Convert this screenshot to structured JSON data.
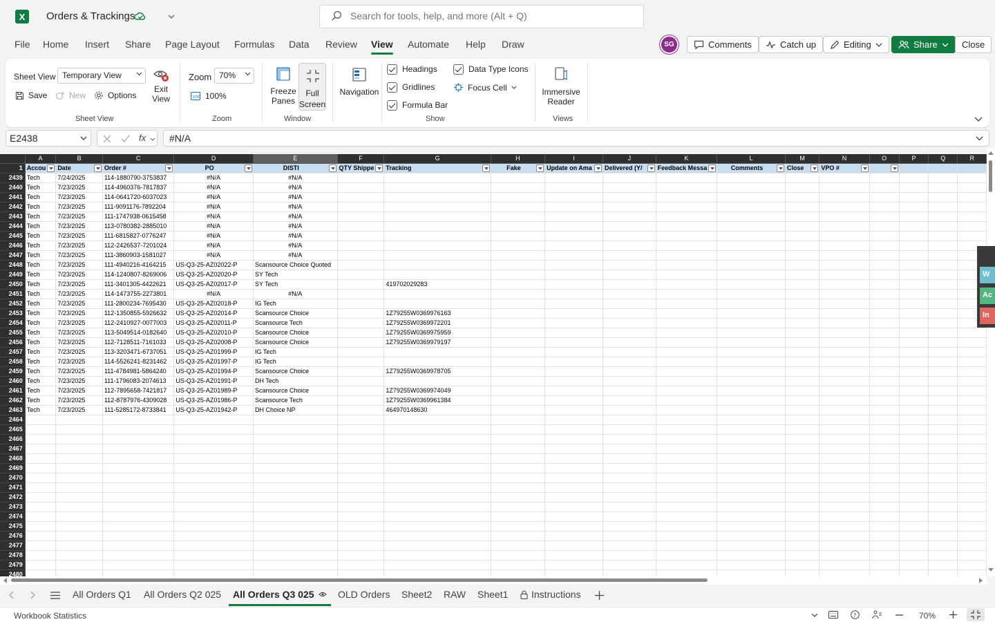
{
  "title": {
    "app_logo": "X",
    "doc_title": "Orders & Trackings"
  },
  "search": {
    "placeholder": "Search for tools, help, and more (Alt + Q)"
  },
  "menu": [
    "File",
    "Home",
    "Insert",
    "Share",
    "Page Layout",
    "Formulas",
    "Data",
    "Review",
    "View",
    "Automate",
    "Help",
    "Draw"
  ],
  "menu_active": "View",
  "account": {
    "initials": "SG"
  },
  "top_buttons": {
    "comments": "Comments",
    "catch_up": "Catch up",
    "editing": "Editing",
    "share": "Share",
    "close": "Close"
  },
  "ribbon": {
    "sheet_view_label": "Sheet View",
    "sheet_view_value": "Temporary View",
    "save": "Save",
    "new": "New",
    "options": "Options",
    "exit": "Exit",
    "view": "View",
    "group_sheet_view": "Sheet View",
    "zoom_label": "Zoom",
    "zoom_value": "70%",
    "zoom_100": "100%",
    "group_zoom": "Zoom",
    "freeze": "Freeze",
    "panes": "Panes",
    "full": "Full",
    "screen": "Screen",
    "group_window": "Window",
    "navigation": "Navigation",
    "headings": "Headings",
    "gridlines": "Gridlines",
    "formula_bar": "Formula Bar",
    "data_type_icons": "Data Type Icons",
    "focus_cell": "Focus Cell",
    "group_show": "Show",
    "immersive": "Immersive",
    "reader": "Reader",
    "group_views": "Views"
  },
  "formula_bar": {
    "name_box": "E2438",
    "content": "#N/A",
    "fx": "fx"
  },
  "columns": [
    "A",
    "B",
    "C",
    "D",
    "E",
    "F",
    "G",
    "H",
    "I",
    "J",
    "K",
    "L",
    "M",
    "N",
    "O",
    "P",
    "Q",
    "R"
  ],
  "selected_column": "E",
  "header_row": {
    "num": "1",
    "cells": [
      "Accou",
      "Date",
      "Order #",
      "PO",
      "DISTI",
      "QTY Shippe",
      "Tracking",
      "Fake",
      "Update on Ama",
      "Delivered (Y/",
      "Feedback Messa",
      "Comments",
      "Close",
      "VPO #",
      "",
      "",
      "",
      ""
    ]
  },
  "rows": [
    {
      "num": "2439",
      "cells": [
        "Tech",
        "7/24/2025",
        "114-1880790-3753837",
        "#N/A",
        "#N/A",
        "",
        "",
        ""
      ]
    },
    {
      "num": "2440",
      "cells": [
        "Tech",
        "7/23/2025",
        "114-4960376-7817837",
        "#N/A",
        "#N/A",
        "",
        "",
        ""
      ]
    },
    {
      "num": "2441",
      "cells": [
        "Tech",
        "7/23/2025",
        "114-0641720-6037023",
        "#N/A",
        "#N/A",
        "",
        "",
        ""
      ]
    },
    {
      "num": "2442",
      "cells": [
        "Tech",
        "7/23/2025",
        "111-9091176-7892204",
        "#N/A",
        "#N/A",
        "",
        "",
        ""
      ]
    },
    {
      "num": "2443",
      "cells": [
        "Tech",
        "7/23/2025",
        "111-1747938-0615458",
        "#N/A",
        "#N/A",
        "",
        "",
        ""
      ]
    },
    {
      "num": "2444",
      "cells": [
        "Tech",
        "7/23/2025",
        "113-0780382-2885010",
        "#N/A",
        "#N/A",
        "",
        "",
        ""
      ]
    },
    {
      "num": "2445",
      "cells": [
        "Tech",
        "7/23/2025",
        "111-6815827-0776247",
        "#N/A",
        "#N/A",
        "",
        "",
        ""
      ]
    },
    {
      "num": "2446",
      "cells": [
        "Tech",
        "7/23/2025",
        "112-2426537-7201024",
        "#N/A",
        "#N/A",
        "",
        "",
        ""
      ]
    },
    {
      "num": "2447",
      "cells": [
        "Tech",
        "7/23/2025",
        "111-3860903-1581027",
        "#N/A",
        "#N/A",
        "",
        "",
        ""
      ]
    },
    {
      "num": "2448",
      "cells": [
        "Tech",
        "7/23/2025",
        "111-4940216-4164215",
        "US-Q3-25-AZ02022-P",
        "Scansource Choice Quoted",
        "",
        "",
        ""
      ]
    },
    {
      "num": "2449",
      "cells": [
        "Tech",
        "7/23/2025",
        "114-1240807-8269006",
        "US-Q3-25-AZ02020-P",
        "SY Tech",
        "",
        "",
        ""
      ]
    },
    {
      "num": "2450",
      "cells": [
        "Tech",
        "7/23/2025",
        "111-3401305-4422621",
        "US-Q3-25-AZ02017-P",
        "SY Tech",
        "",
        "419702029283",
        ""
      ]
    },
    {
      "num": "2451",
      "cells": [
        "Tech",
        "7/23/2025",
        "114-1473755-2273801",
        "#N/A",
        "#N/A",
        "",
        "",
        ""
      ]
    },
    {
      "num": "2452",
      "cells": [
        "Tech",
        "7/23/2025",
        "111-2800234-7695430",
        "US-Q3-25-AZ02018-P",
        "IG Tech",
        "",
        "",
        ""
      ]
    },
    {
      "num": "2453",
      "cells": [
        "Tech",
        "7/23/2025",
        "112-1350855-5926632",
        "US-Q3-25-AZ02014-P",
        "Scansource Choice",
        "",
        "1Z79255W0369976163",
        ""
      ]
    },
    {
      "num": "2454",
      "cells": [
        "Tech",
        "7/23/2025",
        "112-2410927-0077003",
        "US-Q3-25-AZ02011-P",
        "Scansource Tech",
        "",
        "1Z79255W0369972201",
        ""
      ]
    },
    {
      "num": "2455",
      "cells": [
        "Tech",
        "7/23/2025",
        "113-5049514-0182640",
        "US-Q3-25-AZ02010-P",
        "Scansource Choice",
        "",
        "1Z79255W0369975959",
        ""
      ]
    },
    {
      "num": "2456",
      "cells": [
        "Tech",
        "7/23/2025",
        "112-7128511-7161033",
        "US-Q3-25-AZ02008-P",
        "Scansource Choice",
        "",
        "1Z79255W0369979197",
        ""
      ]
    },
    {
      "num": "2457",
      "cells": [
        "Tech",
        "7/23/2025",
        "113-3203471-6737051",
        "US-Q3-25-AZ01999-P",
        "IG Tech",
        "",
        "",
        ""
      ]
    },
    {
      "num": "2458",
      "cells": [
        "Tech",
        "7/23/2025",
        "114-5526241-8231462",
        "US-Q3-25-AZ01997-P",
        "IG Tech",
        "",
        "",
        ""
      ]
    },
    {
      "num": "2459",
      "cells": [
        "Tech",
        "7/23/2025",
        "111-4784981-5864240",
        "US-Q3-25-AZ01994-P",
        "Scansource Choice",
        "",
        "1Z79255W0369978705",
        ""
      ]
    },
    {
      "num": "2460",
      "cells": [
        "Tech",
        "7/23/2025",
        "111-1796083-2074613",
        "US-Q3-25-AZ01991-P",
        "DH Tech",
        "",
        "",
        ""
      ]
    },
    {
      "num": "2461",
      "cells": [
        "Tech",
        "7/23/2025",
        "112-7895658-7421817",
        "US-Q3-25-AZ01989-P",
        "Scansource Choice",
        "",
        "1Z79255W0369974049",
        ""
      ]
    },
    {
      "num": "2462",
      "cells": [
        "Tech",
        "7/23/2025",
        "112-8787976-4309028",
        "US-Q3-25-AZ01986-P",
        "Scansource Tech",
        "",
        "1Z79255W0369961384",
        ""
      ]
    },
    {
      "num": "2463",
      "cells": [
        "Tech",
        "7/23/2025",
        "111-5285172-8733841",
        "US-Q3-25-AZ01942-P",
        "DH Choice NP",
        "",
        "464970148630",
        ""
      ]
    }
  ],
  "empty_rows": [
    "2464",
    "2465",
    "2466",
    "2467",
    "2468",
    "2469",
    "2470",
    "2471",
    "2472",
    "2473",
    "2474",
    "2475",
    "2476",
    "2477",
    "2478",
    "2479",
    "2480"
  ],
  "side_panel": [
    "W",
    "Ac",
    "In"
  ],
  "side_panel_colors": [
    "#6fbfd1",
    "#52b77f",
    "#e0665d"
  ],
  "sheet_tabs": [
    "All Orders Q1",
    "All Orders Q2 025",
    "All Orders Q3 025",
    "OLD Orders",
    "Sheet2",
    "RAW",
    "Sheet1",
    "Instructions"
  ],
  "active_tab": "All Orders Q3 025",
  "status": {
    "left": "Workbook Statistics",
    "zoom": "70%"
  },
  "colors": {
    "accent": "#107c41",
    "header_fill": "#c9ddf1",
    "avatar": "#8e2a8f"
  }
}
